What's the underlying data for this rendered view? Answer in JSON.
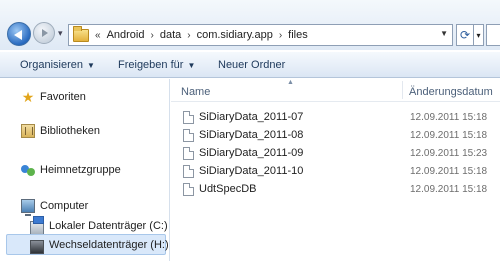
{
  "address_bar": {
    "overflow_glyph": "«",
    "breadcrumbs": [
      "Android",
      "data",
      "com.sidiary.app",
      "files"
    ],
    "separator": "›"
  },
  "toolbar": {
    "organize_label": "Organisieren",
    "share_label": "Freigeben für",
    "new_folder_label": "Neuer Ordner"
  },
  "sidebar": {
    "favorites": "Favoriten",
    "libraries": "Bibliotheken",
    "homegroup": "Heimnetzgruppe",
    "computer": "Computer",
    "local_drive": "Lokaler Datenträger (C:)",
    "removable_drive": "Wechseldatenträger (H:)"
  },
  "columns": {
    "name": "Name",
    "modified": "Änderungsdatum"
  },
  "files": [
    {
      "name": "SiDiaryData_2011-07",
      "modified": "12.09.2011 15:18"
    },
    {
      "name": "SiDiaryData_2011-08",
      "modified": "12.09.2011 15:18"
    },
    {
      "name": "SiDiaryData_2011-09",
      "modified": "12.09.2011 15:23"
    },
    {
      "name": "SiDiaryData_2011-10",
      "modified": "12.09.2011 15:18"
    },
    {
      "name": "UdtSpecDB",
      "modified": "12.09.2011 15:18"
    }
  ],
  "colors": {
    "selection": "#d9e8fa",
    "toolbar_text": "#1e395b"
  }
}
